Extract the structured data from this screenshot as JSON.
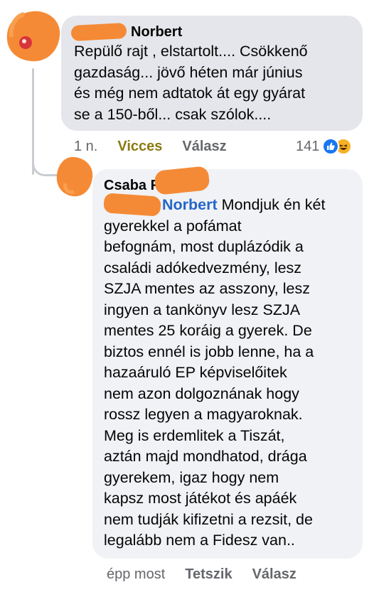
{
  "comment1": {
    "author": "Norbert",
    "text_lines": [
      "Repülő rajt , elstartolt.... Csökkenő",
      "gazdaság... jövő héten már június",
      "és még nem adtatok át egy gyárat",
      "se a 150-ből... csak szólok...."
    ],
    "time": "1 n.",
    "reaction_label": "Vicces",
    "reply_label": "Válasz",
    "reaction_count": "141",
    "reaction_icons": [
      "like-icon",
      "haha-icon"
    ]
  },
  "comment2": {
    "author": "Csaba R",
    "mention": "Norbert",
    "text_first": " Mondjuk én két",
    "text_lines": [
      "gyerekkel a pofámat",
      "befognám, most duplázódik a",
      "családi adókedvezmény, lesz",
      "SZJA mentes az asszony, lesz",
      "ingyen a tankönyv lesz SZJA",
      "mentes 25 koráig a gyerek. De",
      "biztos ennél is jobb lenne, ha a",
      "hazaáruló EP képviselőitek",
      "nem azon dolgoznának hogy",
      "rossz legyen a magyaroknak.",
      "Meg is erdemlitek a Tiszát,",
      "aztán majd mondhatod, drága",
      "gyerekem, igaz hogy nem",
      "kapsz most játékot és apáék",
      "nem tudják kifizetni a rezsit, de",
      "legalább nem a Fidesz van.."
    ],
    "time": "épp most",
    "like_label": "Tetszik",
    "reply_label": "Válasz"
  },
  "colors": {
    "bubble1": "#e4e6eb",
    "bubble2": "#f0f2f5",
    "mention": "#2566c9",
    "redaction": "#f58a36",
    "meta_text": "#65676b"
  }
}
